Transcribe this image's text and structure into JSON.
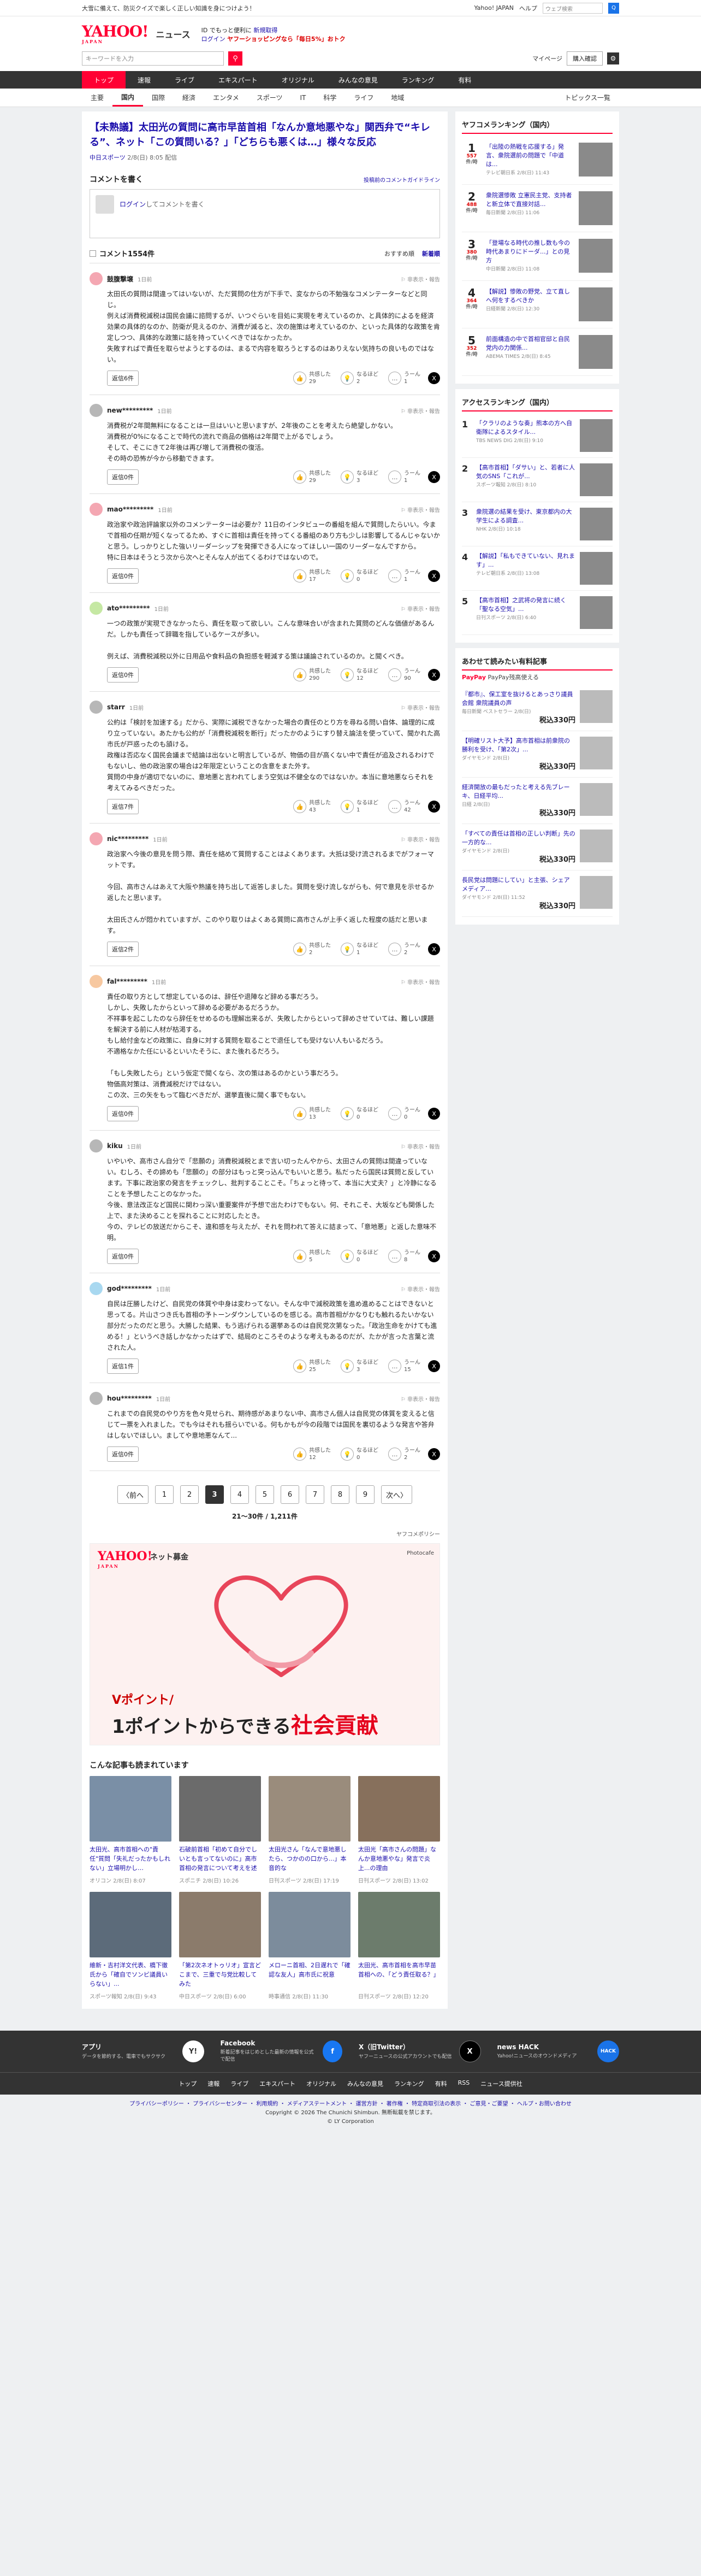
{
  "topbar": {
    "notice": "大雪に備えて、防災クイズで楽しく正しい知識を身につけよう！",
    "links": [
      "Yahoo! JAPAN",
      "ヘルプ"
    ],
    "search_placeholder": "ウェブ検索",
    "search_button": "Q"
  },
  "header": {
    "logo": "YAHOO!",
    "logo_sub": "JAPAN",
    "logo_news": "ニュース",
    "promo_line1_a": "ID でもっと便利に",
    "promo_line1_b": "新規取得",
    "promo_line2_a": "ログイン",
    "promo_line2_b": "ヤフーショッピングなら「毎日5%」おトク"
  },
  "searchrow": {
    "placeholder": "キーワードを入力",
    "mypage": "マイページ",
    "login": "購入確認"
  },
  "nav_main": [
    "トップ",
    "速報",
    "ライブ",
    "エキスパート",
    "オリジナル",
    "みんなの意見",
    "ランキング",
    "有料"
  ],
  "nav_sub": [
    "主要",
    "国内",
    "国際",
    "経済",
    "エンタメ",
    "スポーツ",
    "IT",
    "科学",
    "ライフ",
    "地域"
  ],
  "nav_sub_right": "トピックス一覧",
  "article": {
    "title": "【未熟議】太田光の質問に高市早苗首相「なんか意地悪やな」関西弁で“キレる”、ネット「この質問いる？」「どちらも悪くは…」様々な反応",
    "source": "中日スポーツ",
    "date": "2/8(日) 8:05 配信"
  },
  "comment_section": {
    "label": "コメントを書く",
    "guidelines": "投稿前のコメントガイドライン",
    "login_link": "ログイン",
    "placeholder": "してコメントを書く",
    "count_label": "コメント1554件",
    "sort_recommend": "おすすめ順",
    "sort_new": "新着順"
  },
  "reactions": {
    "agree": "共感した",
    "insight": "なるほど",
    "disagree": "うーん",
    "reply": "返信"
  },
  "comments": [
    {
      "name": "鼓腹撃壌",
      "time": "1日前",
      "color": "#f4a7b2",
      "text": "太田氏の質問は間違ってはいないが、ただ質問の仕方が下手で、変なからの不勉強なコメンテーターなどと同じ。\n例えば消費税減税は国民会議に諮問するが、いつぐらいを目処に実現を考えているのか、と具体的によるを経済効果の具体的なのか、防衛が見えるのか、消費が減ると、次の施策は考えているのか、といった具体的な政策を肯定しつつ、具体的な政策に話を持っていくべきではなかったか。\n失敗すればで責任を取らせようとするのは、まるで内容を取ろうとするのはありえない気持ちの良いものではない。",
      "replies": "6",
      "agree": "29",
      "insight": "2",
      "disagree": "1"
    },
    {
      "name": "new*********",
      "time": "1日前",
      "color": "#b7b7b7",
      "text": "消費税が2年間無料になることは一旦はいいと思いますが、2年後のことを考えたら絶望しかない。\n消費税が0%になることで時代の流れで商品の価格は2年間で上がるでしょう。\nそして、そこにきて2年後は再び増して消費税の復活。\nその時の恐怖が今から移動できます。",
      "replies": "0",
      "agree": "29",
      "insight": "3",
      "disagree": "1"
    },
    {
      "name": "mao*********",
      "time": "1日前",
      "color": "#f4a7b2",
      "text": "政治家や政治評論家以外のコメンテーターは必要か？11日のインタビューの番組を組んで質問したらいい。今まで首相の任期が短くなってるため、すぐに首相は責任を持ってくる番組のあり方も少しは影響してるんじゃないかと思う。しっかりとした強いリーダーシップを発揮できる人になってほしい一国のリーダーなんですから。\n特に日本はそうとう次から次へとそんな人が出てくるわけではないので。",
      "replies": "0",
      "agree": "17",
      "insight": "0",
      "disagree": "1"
    },
    {
      "name": "ato*********",
      "time": "1日前",
      "color": "#c5e8a3",
      "text": "一つの政策が実現できなかったら、責任を取って欲しい。こんな意味合いが含まれた質問のどんな価値があるんだ。しかも責任って辞職を指しているケースが多い。\n\n例えば、消費税減税以外に日用品や食料品の負担感を軽減する策は議論されているのか。と聞くべき。",
      "replies": "0",
      "agree": "290",
      "insight": "12",
      "disagree": "90"
    },
    {
      "name": "starr",
      "time": "1日前",
      "color": "#b7b7b7",
      "text": "公約は「検討を加速する」だから、実際に減税できなかった場合の責任のとり方を尋ねる問い自体、論理的に成り立っていない。あたかも公約が「消費税減税を断行」だったかのようにすり替え論法を使っていて、聞かれた高市氏が戸惑ったのも頷ける。\n政権は否応なく国民会議まで結論は出ないと明言しているが、物価の目が高くない中で責任が追及されるわけでもないし、他の政治家の場合は2年限定ということの含意をまた外す。\n質問の中身が適切でないのに、意地悪と言われてしまう空気は不健全なのではないか。本当に意地悪ならそれを考えてみるべきだった。",
      "replies": "7",
      "agree": "43",
      "insight": "1",
      "disagree": "42"
    },
    {
      "name": "nic*********",
      "time": "1日前",
      "color": "#f4a7b2",
      "text": "政治家へ今後の意見を問う際、責任を絡めて質問することはよくあります。大抵は受け流されるまでがフォーマットです。\n\n今回、高市さんはあえて大阪や熟議を持ち出して返答しました。質問を受け流しながらも、何で意見を示せるか返したと思います。\n\n太田氏さんが悶かれていますが、このやり取りはよくある質問に高市さんが上手く返した程度の話だと思います。",
      "replies": "2",
      "agree": "2",
      "insight": "1",
      "disagree": "2"
    },
    {
      "name": "fal*********",
      "time": "1日前",
      "color": "#f7c8a0",
      "text": "責任の取り方として想定しているのは、辞任や退陣など辞める事だろう。\nしかし、失敗したからといって辞める必要があるだろうか。\n不祥事を起こしたのなら辞任をせめるのも理解出来るが、失敗したからといって辞めさせていては、難しい課題を解決する前に人材が枯渇する。\nもし給付金などの政策に、自身に対する質問を取ることで退任しても受けない人もいるだろう。\n不適格なかた任にいるといいたそうに、また後れるだろう。\n\n「もし失敗したら」という仮定で聞くなら、次の策はあるのかという事だろう。\n物価高対策は、消費減税だけではない。\nこの次、三の矢をもって臨むべきだが、選挙直後に聞く事でもない。",
      "replies": "0",
      "agree": "13",
      "insight": "0",
      "disagree": "0"
    },
    {
      "name": "kiku",
      "time": "1日前",
      "color": "#b7b7b7",
      "text": "いやいや、高市さん自分で「悲願の」消費税減税とまで言い切ったんやから、太田さんの質問は間違っていない。むしろ、その諦めも「悲願の」の部分はもっと突っ込んでもいいと思う。私だったら国民は質問と反しています。下事に政治家の発言をチェックし、批判することこそ。「ちょっと待って、本当に大丈夫？」と冷静になることを予想したことのなかった。\n今後、意法改正など国民に関わっ深い重要案件が予想で出たわけでもない。何、それこそ、大坂なども関係した上で、また決めることを探れることに対応したとき。\n今の、テレビの放送だからこそ、違和感を与えたが、それを問われて答えに詰まって、「意地悪」と返した意味不明。",
      "replies": "0",
      "agree": "5",
      "insight": "0",
      "disagree": "8"
    },
    {
      "name": "god*********",
      "time": "1日前",
      "color": "#a8d8f0",
      "text": "自民は圧勝したけど、自民党の体質や中身は変わってない。そんな中で減税政策を進め進めることはできないと思ってる。片山さつき氏も首相の予トーンダウンしているのを感じる。高市首相がかなりむも触れるたいかない部分だったのだと思う。大勝した結果、もう逃げられる選挙あるのは自民党次第なった。「政治生命をかけても進める！」というべき話しかなかったはずで、結局のところそのような考えもあるのだが、たかが言った言葉と流された人。",
      "replies": "1",
      "agree": "25",
      "insight": "3",
      "disagree": "15"
    },
    {
      "name": "hou*********",
      "time": "1日前",
      "color": "#b7b7b7",
      "text": "これまでの自民党のやり方を色々見せられ、期待感があまりない中、高市さん個人は自民党の体質を変えると信じて一票を入れました。でも今はそれも揺らいでいる。何もかもが今の段階では国民を裏切るような発言や答弁はしないでほしい。ましてや意地悪なんて...",
      "replies": "0",
      "agree": "12",
      "insight": "0",
      "disagree": "2"
    }
  ],
  "pager": {
    "prev": "〈前へ",
    "next": "次へ〉",
    "pages": [
      "1",
      "2",
      "3",
      "4",
      "5",
      "6",
      "7",
      "8",
      "9"
    ],
    "current": "3",
    "count": "21〜30件 / 1,211件"
  },
  "policy": "ヤフコメポリシー",
  "banner": {
    "logo": "YAHOO!",
    "logo_sub": "JAPAN",
    "service": "ネット募金",
    "photo_credit": "Photocafe",
    "line1": "Vポイント/",
    "line2_a": "1ポイントからできる",
    "line2_b": "社会貢献"
  },
  "related": {
    "title": "こんな記事も読まれています",
    "items": [
      {
        "title": "太田光、高市首相への\"責任\"質問「失礼だったかもしれない」立場明かし…",
        "source": "オリコン",
        "date": "2/8(日) 8:07"
      },
      {
        "title": "石破前首相「初めて自分でしいとも言ってないのに」高市首相の発言について考えを述べる",
        "source": "スポニチ",
        "date": "2/8(日) 10:26"
      },
      {
        "title": "太田光さん「なんで意地悪したら、つかのの口から...」本音的な",
        "source": "日刊スポーツ",
        "date": "2/8(日) 17:19"
      },
      {
        "title": "太田光「高市さんの問題」なんか意地悪やな」発言で炎上...の理由",
        "source": "日刊スポーツ",
        "date": "2/8(日) 13:02"
      },
      {
        "title": "維新・吉村洋文代表、橋下徹氏から「確自でソンビ議員いらない」...",
        "source": "スポーツ報知",
        "date": "2/8(日) 9:43"
      },
      {
        "title": "「第2次ネオトゥリオ」宣言どこまで、三重で与党比較してみた",
        "source": "中日スポーツ",
        "date": "2/8(日) 6:00"
      },
      {
        "title": "メローニ首相、2日遅れで「確認な友人」高市氏に祝意",
        "source": "時事通信",
        "date": "2/8(日) 11:30"
      },
      {
        "title": "太田光、高市首相を高市早苗首相への、「どう責任取る？」",
        "source": "日刊スポーツ",
        "date": "2/8(日) 12:20"
      }
    ]
  },
  "sidebar": {
    "ranking_title": "ヤフコメランキング（国内）",
    "ranking": [
      {
        "num": "1",
        "count": "557",
        "delta": "件/時",
        "title": "「出陸の熱戦を応援する」発言、衆院選前の問題で「中道は...",
        "meta": "テレビ朝日系 2/8(日) 11:43"
      },
      {
        "num": "2",
        "count": "488",
        "delta": "件/時",
        "title": "衆院選惨敗 立憲民主党、支持者と新立体で直接対話...",
        "meta": "毎日新聞 2/8(日) 11:06"
      },
      {
        "num": "3",
        "count": "380",
        "delta": "件/時",
        "title": "「登場なる時代の推し数も今の時代あまりにドーダ...」との見方",
        "meta": "中日新聞 2/8(日) 11:08"
      },
      {
        "num": "4",
        "count": "364",
        "delta": "件/時",
        "title": "【解説】惨敗の野党、立て直しへ何をするべきか",
        "meta": "日経新聞 2/8(日) 12:30"
      },
      {
        "num": "5",
        "count": "352",
        "delta": "件/時",
        "title": "前面構造の中で首相官邸と自民党内の力関係...",
        "meta": "ABEMA TIMES 2/8(日) 8:45"
      }
    ],
    "access_title": "アクセスランキング（国内）",
    "access": [
      {
        "num": "1",
        "title": "「クラリのような奏」熊本の方へ自衛隊によるスタイル...",
        "meta": "TBS NEWS DIG 2/8(日) 9:10"
      },
      {
        "num": "2",
        "title": "【高市首相】「ダサい」と、若者に人気のSNS「これが...",
        "meta": "スポーツ報知 2/8(日) 8:10"
      },
      {
        "num": "3",
        "title": "衆院選の結果を受け、東京都内の大学生による調査...",
        "meta": "NHK 2/8(日) 10:18"
      },
      {
        "num": "4",
        "title": "【解説】「私もできていない、見れます」...",
        "meta": "テレビ朝日系 2/8(日) 13:08"
      },
      {
        "num": "5",
        "title": "【高市首相】之武将の発言に続く「聖なる空気」...",
        "meta": "日刊スポーツ 2/8(日) 6:40"
      }
    ],
    "shop_title": "あわせて読みたい有料記事",
    "paypay": "PayPay残高使える",
    "paypay_b": "PayPay",
    "shop": [
      {
        "title": "『都市』、保工室を抜けるとあっさり議員会館 衆院議員の声",
        "meta": "毎日新聞 ベストセラー 2/8(日)",
        "price": "税込330円"
      },
      {
        "title": "【明確リスト大予】高市首相は前衆院の勝利を受け、「第2次」...",
        "meta": "ダイヤモンド 2/8(日)",
        "price": "税込330円"
      },
      {
        "title": "経済開放の最もだったと考える先ブレーキ、日経平均...",
        "meta": "日経 2/8(日)",
        "price": "税込330円"
      },
      {
        "title": "「すべての責任は首相の正しい判断」先の一方的な...",
        "meta": "ダイヤモンド 2/8(日)",
        "price": "税込330円"
      },
      {
        "title": "長民党は問題にしてい」と主張、シェアメディア...",
        "meta": "ダイヤモンド 2/8(日) 11:52",
        "price": "税込330円"
      }
    ]
  },
  "footer": {
    "items": [
      {
        "title": "アプリ",
        "desc": "データを節約する、電車でもサクサク",
        "icon": "Y!"
      },
      {
        "title": "Facebook",
        "desc": "新着記事をはじめとした最新の情報を公式で配信",
        "icon": "f"
      },
      {
        "title": "X（旧Twitter）",
        "desc": "ヤフーニュースの公式アカウントでも配信",
        "icon": "X"
      },
      {
        "title": "news HACK",
        "desc": "Yahoo!ニュースのオウンドメディア",
        "icon": "HACK"
      }
    ],
    "links": [
      "トップ",
      "速報",
      "ライブ",
      "エキスパート",
      "オリジナル",
      "みんなの意見",
      "ランキング",
      "有料",
      "RSS",
      "ニュース提供社"
    ],
    "bottom_links": "プライバシーポリシー ・ プライバシーセンター ・ 利用規約 ・ メディアステートメント ・ 運営方針 ・ 著作権 ・ 特定商取引法の表示 ・ ご意見・ご要望 ・ ヘルプ・お問い合わせ",
    "copyright1": "Copyright © 2026 The Chunichi Shimbun. 無断転載を禁じます。",
    "copyright2": "© LY Corporation"
  }
}
